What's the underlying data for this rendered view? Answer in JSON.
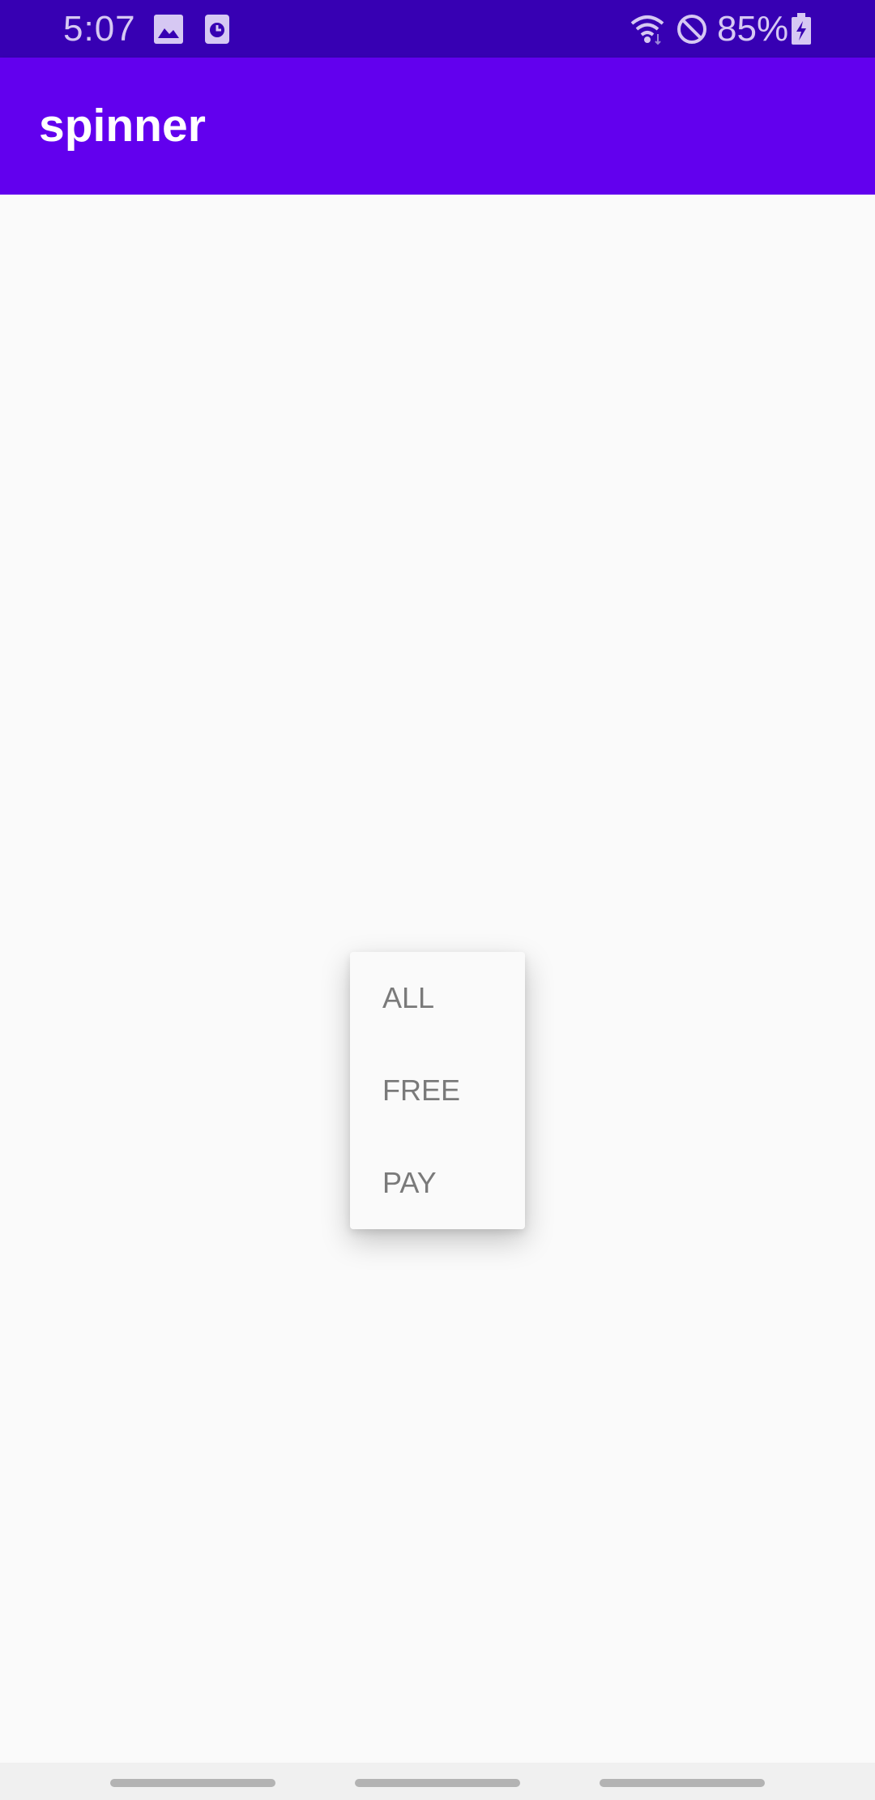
{
  "status_bar": {
    "time": "5:07",
    "battery": "85%",
    "icons": [
      "image-icon",
      "clock-icon",
      "wifi-icon",
      "do-not-disturb-icon",
      "battery-charging-icon"
    ]
  },
  "app_bar": {
    "title": "spinner"
  },
  "spinner_menu": {
    "items": [
      {
        "label": "ALL"
      },
      {
        "label": "FREE"
      },
      {
        "label": "PAY"
      }
    ]
  },
  "colors": {
    "status_bar": "#3700b3",
    "app_bar": "#6200ee",
    "background": "#fafafa",
    "menu_text": "#7a7a7a"
  }
}
